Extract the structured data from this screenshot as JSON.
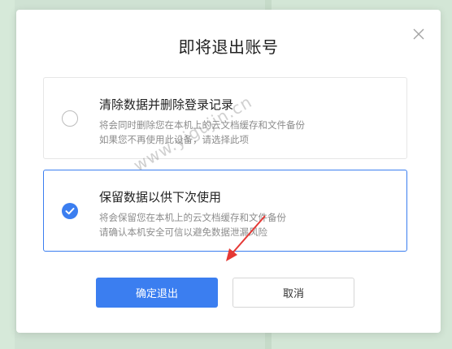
{
  "dialog": {
    "title": "即将退出账号",
    "close_icon": "close-icon"
  },
  "options": [
    {
      "title": "清除数据并删除登录记录",
      "desc1": "将会同时删除您在本机上的云文档缓存和文件备份",
      "desc2": "如果您不再使用此设备，请选择此项",
      "selected": false
    },
    {
      "title": "保留数据以供下次使用",
      "desc1": "将会保留您在本机上的云文档缓存和文件备份",
      "desc2": "请确认本机安全可信以避免数据泄漏风险",
      "selected": true
    }
  ],
  "buttons": {
    "confirm_label": "确定退出",
    "cancel_label": "取消"
  },
  "watermark": "www.yigujin.cn",
  "colors": {
    "accent": "#3b7ef0",
    "annotation_arrow": "#e53935"
  }
}
